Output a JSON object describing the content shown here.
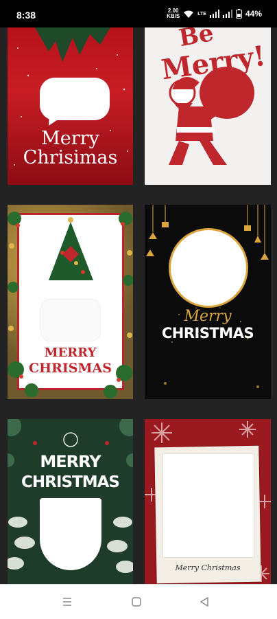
{
  "status_bar": {
    "time": "8:38",
    "net_speed_value": "2.00",
    "net_speed_unit": "KB/S",
    "battery": "44%"
  },
  "cards": [
    {
      "name": "card-red-merry-chrisimas",
      "line1": "Merry",
      "line2": "Chrisimas"
    },
    {
      "name": "card-be-merry-santa",
      "line1": "Be",
      "line2": "Merry!"
    },
    {
      "name": "card-tree-frame",
      "line1": "MERRY",
      "line2": "CHRISMAS"
    },
    {
      "name": "card-gold-circle",
      "line1": "Merry",
      "line2": "CHRISTMAS"
    },
    {
      "name": "card-green-leaves",
      "line1": "MERRY",
      "line2": "CHRISTMAS"
    },
    {
      "name": "card-polaroid",
      "line1": "Merry Christmas"
    }
  ],
  "colors": {
    "background": "#232323",
    "red": "#c81d25",
    "gold": "#d9a53c",
    "green": "#1f3c2a"
  },
  "nav": {
    "recent_icon": "recents-icon",
    "home_icon": "home-icon",
    "back_icon": "back-icon"
  }
}
